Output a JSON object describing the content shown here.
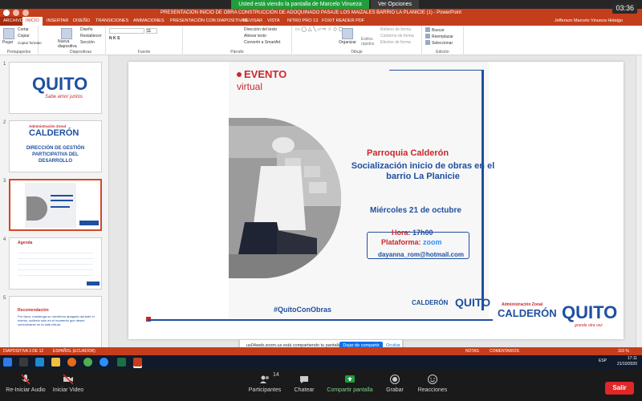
{
  "zoom": {
    "share_banner": "Usted está viendo la pantalla de Marcelo Vinueza",
    "view_options": "Ver Opciones",
    "clock": "03:36"
  },
  "ppt": {
    "window_title": "PRESENTACION INICIO DE OBRA CONSTRUCCIÓN DE ADOQUINADO PASAJE LOS MAIZALES BARRIO LA PLANICIE (1) - PowerPoint",
    "user": "Jefferson Marcelo Vinueza Hidalgo",
    "tabs": [
      "ARCHIVO",
      "INICIO",
      "INSERTAR",
      "DISEÑO",
      "TRANSICIONES",
      "ANIMACIONES",
      "PRESENTACIÓN CON DIAPOSITIVAS",
      "REVISAR",
      "VISTA",
      "NITRO PRO 13",
      "FOXIT READER PDF"
    ],
    "ribbon": {
      "clipboard": {
        "label": "Portapapeles",
        "paste": "Pegar",
        "cut": "Cortar",
        "copy": "Copiar",
        "format": "Copiar formato"
      },
      "slides": {
        "label": "Diapositivas",
        "new": "Nueva diapositiva",
        "layout": "Diseño",
        "reset": "Restablecer",
        "section": "Sección"
      },
      "font": {
        "label": "Fuente",
        "size": "11"
      },
      "paragraph": {
        "label": "Párrafo",
        "direction": "Dirección del texto",
        "align": "Alinear texto",
        "smartart": "Convertir a SmartArt"
      },
      "drawing": {
        "label": "Dibujo",
        "arrange": "Organizar",
        "styles": "Estilos rápidos",
        "fill": "Relleno de forma",
        "outline": "Contorno de forma",
        "effects": "Efectos de forma"
      },
      "editing": {
        "label": "Edición",
        "find": "Buscar",
        "replace": "Reemplazar",
        "select": "Seleccionar"
      }
    },
    "thumbnails": [
      {
        "num": "1",
        "logo": "QUITO",
        "sub": "Sabe amor juntos"
      },
      {
        "num": "2",
        "az": "Administración Zonal",
        "calderon": "CALDERÓN",
        "body": "DIRECCIÓN DE GESTIÓN PARTICIPATIVA DEL DESARROLLO"
      },
      {
        "num": "3"
      },
      {
        "num": "4",
        "title": "Agenda"
      },
      {
        "num": "5",
        "title": "Recomendación",
        "body": "Por favor, mantenga su micrófono apagado durante el evento, activelo solo en el momento que desee comunicarse en la sala virtual."
      }
    ],
    "slide": {
      "evento": "EVENTO",
      "virtual": "virtual",
      "parroquia": "Parroquia Calderón",
      "socializacion": "Socialización inicio de obras en el barrio La Planicie",
      "fecha": "Miércoles 21 de octubre",
      "hora_label": "Hora:",
      "hora": "17h00",
      "plataforma_label": "Plataforma:",
      "plataforma": "zoom",
      "email": "dayanna_rom@hotmail.com",
      "hashtag": "#QuitoConObras",
      "footer_az": "Administración Zonal",
      "footer_calderon": "CALDERÓN",
      "footer_quito": "QUITO",
      "footer_sub": "grande otra vez"
    },
    "status": {
      "slide_of": "DIAPOSITIVA 3 DE 12",
      "language": "ESPAÑOL (ECUADOR)",
      "notes": "NOTAS",
      "comments": "COMENTARIOS",
      "zoom": "116 %"
    }
  },
  "share_note": {
    "text": "us04web.zoom.us está compartiendo tu pantalla.",
    "stop": "Dejar de compartir",
    "hide": "Ocultar"
  },
  "taskbar": {
    "time": "17:11",
    "date": "21/10/2020",
    "lang": "ESP"
  },
  "zoombar": {
    "audio": "Re-Iniciar Audio",
    "video": "Iniciar Video",
    "participants": "Participantes",
    "participants_count": "14",
    "chat": "Chatear",
    "share": "Compartir pantalla",
    "record": "Grabar",
    "reactions": "Reacciones",
    "leave": "Salir"
  }
}
